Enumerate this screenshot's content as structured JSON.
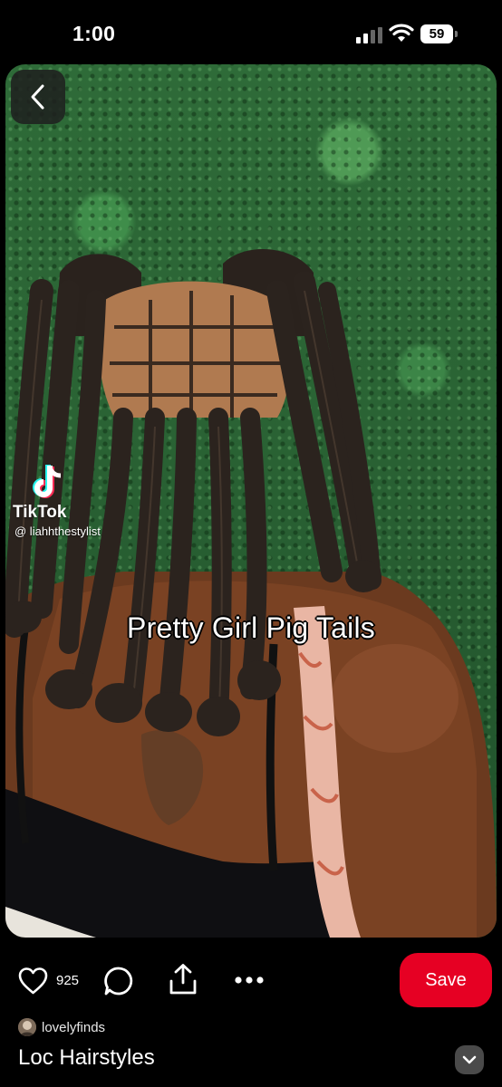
{
  "status_bar": {
    "time": "1:00",
    "battery": "59"
  },
  "media": {
    "watermark": {
      "app_name": "TikTok",
      "handle": "@ liahhthestylist"
    },
    "caption": "Pretty Girl Pig Tails"
  },
  "actions": {
    "like_count": "925",
    "save_label": "Save"
  },
  "pin": {
    "creator": "lovelyfinds",
    "title": "Loc Hairstyles"
  },
  "icons": [
    "back-icon",
    "heart-icon",
    "comment-icon",
    "share-icon",
    "more-icon",
    "chevron-down-icon",
    "tiktok-logo"
  ],
  "colors": {
    "save_button": "#e60023",
    "background": "#000000",
    "expand_button": "#4a4a4a"
  }
}
